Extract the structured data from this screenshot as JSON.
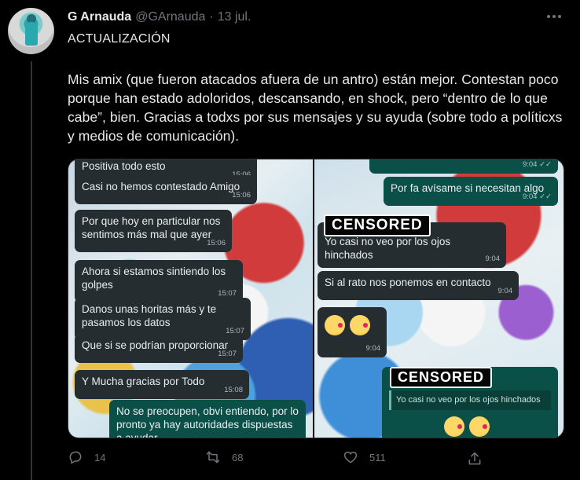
{
  "tweet": {
    "author_name": "G Arnauda",
    "author_handle": "@GArnauda",
    "separator": "·",
    "date": "13 jul.",
    "title": "ACTUALIZACIÓN",
    "body": "Mis amix (que fueron atacados afuera de un antro) están mejor. Contestan poco porque han estado adoloridos, descansando, en shock, pero “dentro de lo que cabe”, bien. Gracias a todxs por sus mensajes y su ayuda (sobre todo a políticxs y medios de comunicación)."
  },
  "media": {
    "left_chat": [
      {
        "text": "Positiva todo esto",
        "time": "15:06",
        "dir": "in"
      },
      {
        "text": "Casi no hemos contestado Amigo",
        "time": "15:06",
        "dir": "in"
      },
      {
        "text": "Por que hoy en particular nos sentimos más mal que ayer",
        "time": "15:06",
        "dir": "in"
      },
      {
        "text": "Ahora si estamos sintiendo los golpes",
        "time": "15:07",
        "dir": "in"
      },
      {
        "text": "Danos unas horitas más y te pasamos los datos",
        "time": "15:07",
        "dir": "in"
      },
      {
        "text": "Que si se podrían proporcionar",
        "time": "15:07",
        "dir": "in"
      },
      {
        "text": "Y Mucha gracias por Todo",
        "time": "15:08",
        "dir": "in"
      },
      {
        "text": "No se preocupen, obvi entiendo, por lo pronto ya hay autoridades dispuestas a ayudar",
        "time": "",
        "dir": "out"
      }
    ],
    "right_chat": [
      {
        "text": "",
        "time": "9:04 ✓✓",
        "dir": "out"
      },
      {
        "text": "Por fa avísame si necesitan algo",
        "time": "9:04 ✓✓",
        "dir": "out"
      },
      {
        "text": "Yo casi no veo por los ojos hinchados",
        "time": "9:04",
        "dir": "in"
      },
      {
        "text": "Si al rato nos ponemos en contacto",
        "time": "9:04",
        "dir": "in"
      },
      {
        "text": "",
        "time": "9:04",
        "dir": "in"
      },
      {
        "text": "Yo casi no veo por los ojos hinchados",
        "time": "",
        "dir": "quote"
      }
    ],
    "censor_label": "CENSORED"
  },
  "actions": {
    "reply_count": "14",
    "retweet_count": "68",
    "like_count": "511"
  },
  "icons": [
    "reply-icon",
    "retweet-icon",
    "like-icon",
    "share-icon",
    "more-icon"
  ],
  "colors": {
    "background": "#000000",
    "text": "#e7e9ea",
    "muted": "#71767b",
    "bubble_in": "#262d31",
    "bubble_out": "#0b5048"
  }
}
